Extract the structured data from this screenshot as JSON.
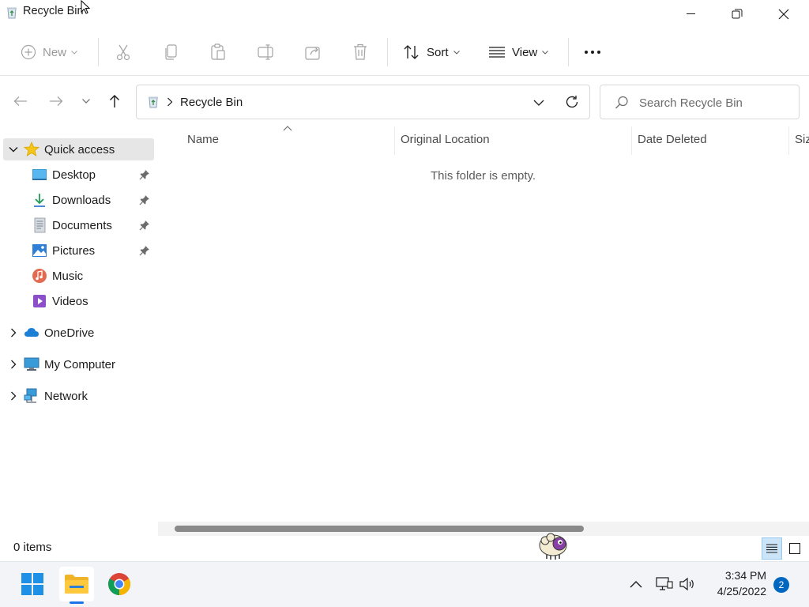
{
  "window": {
    "title": "Recycle Bin"
  },
  "toolbar": {
    "new_label": "New",
    "sort_label": "Sort",
    "view_label": "View"
  },
  "address": {
    "location": "Recycle Bin"
  },
  "search": {
    "placeholder": "Search Recycle Bin"
  },
  "sidebar": {
    "quick_access": "Quick access",
    "items": [
      {
        "label": "Desktop",
        "pinned": true
      },
      {
        "label": "Downloads",
        "pinned": true
      },
      {
        "label": "Documents",
        "pinned": true
      },
      {
        "label": "Pictures",
        "pinned": true
      },
      {
        "label": "Music",
        "pinned": false
      },
      {
        "label": "Videos",
        "pinned": false
      }
    ],
    "onedrive": "OneDrive",
    "my_computer": "My Computer",
    "network": "Network"
  },
  "content": {
    "columns": [
      "Name",
      "Original Location",
      "Date Deleted",
      "Siz"
    ],
    "empty_message": "This folder is empty."
  },
  "status": {
    "item_count": "0 items"
  },
  "taskbar": {
    "time": "3:34 PM",
    "date": "4/25/2022",
    "notification_count": "2"
  },
  "colors": {
    "accent": "#0067c0",
    "selected_nav": "#e6e6e6"
  }
}
